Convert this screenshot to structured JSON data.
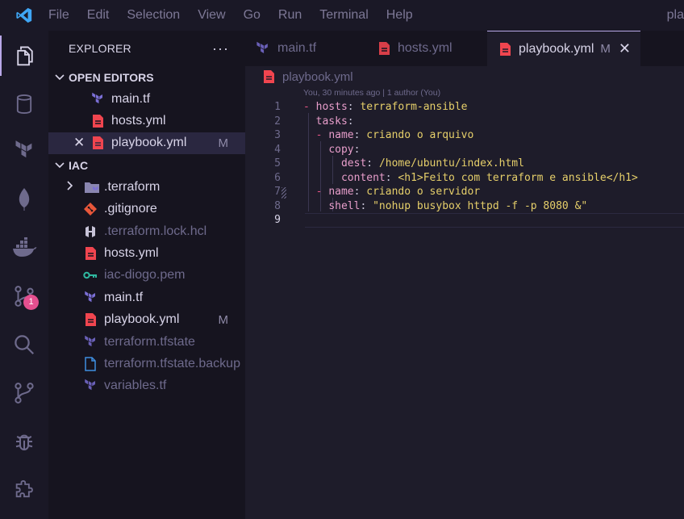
{
  "titlebar": {
    "menu": [
      "File",
      "Edit",
      "Selection",
      "View",
      "Go",
      "Run",
      "Terminal",
      "Help"
    ],
    "title": "pla"
  },
  "activitybar": {
    "items": [
      "files-icon",
      "database-icon",
      "terraform-icon",
      "mongodb-leaf-icon",
      "docker-icon",
      "source-control-icon",
      "search-icon",
      "git-graph-icon",
      "debug-icon",
      "extensions-icon"
    ],
    "scm_badge": "1"
  },
  "explorer": {
    "title": "EXPLORER",
    "more": "···",
    "open_editors_label": "OPEN EDITORS",
    "open_editors": [
      {
        "name": "main.tf",
        "icon": "terraform-icon"
      },
      {
        "name": "hosts.yml",
        "icon": "yaml-icon"
      },
      {
        "name": "playbook.yml",
        "icon": "yaml-icon",
        "status": "M"
      }
    ],
    "folder_label": "IAC",
    "files": [
      {
        "name": ".terraform",
        "icon": "folder-terraform-icon"
      },
      {
        "name": ".gitignore",
        "icon": "git-icon"
      },
      {
        "name": ".terraform.lock.hcl",
        "icon": "hcl-icon"
      },
      {
        "name": "hosts.yml",
        "icon": "yaml-icon"
      },
      {
        "name": "iac-diogo.pem",
        "icon": "key-icon"
      },
      {
        "name": "main.tf",
        "icon": "terraform-icon"
      },
      {
        "name": "playbook.yml",
        "icon": "yaml-icon",
        "status": "M"
      },
      {
        "name": "terraform.tfstate",
        "icon": "terraform-icon"
      },
      {
        "name": "terraform.tfstate.backup",
        "icon": "file-icon"
      },
      {
        "name": "variables.tf",
        "icon": "terraform-icon"
      }
    ]
  },
  "tabs": [
    {
      "label": "main.tf"
    },
    {
      "label": "hosts.yml"
    },
    {
      "label": "playbook.yml",
      "status": "M",
      "close": "✕"
    }
  ],
  "breadcrumb": "playbook.yml",
  "editor": {
    "blame": "You, 30 minutes ago | 1 author (You)",
    "line_numbers": [
      "1",
      "2",
      "3",
      "4",
      "5",
      "6",
      "7",
      "8",
      "9"
    ],
    "lines": [
      {
        "dash": "- ",
        "key": "hosts",
        "colon": ": ",
        "value": "terraform-ansible"
      },
      {
        "key": "tasks",
        "colon": ":"
      },
      {
        "dash": "- ",
        "key": "name",
        "colon": ": ",
        "value": "criando o arquivo"
      },
      {
        "key": "copy",
        "colon": ":"
      },
      {
        "key": "dest",
        "colon": ": ",
        "value": "/home/ubuntu/index.html"
      },
      {
        "key": "content",
        "colon": ": ",
        "value": "<h1>Feito com terraform e ansible</h1>"
      },
      {
        "dash": "- ",
        "key": "name",
        "colon": ": ",
        "value": "criando o servidor"
      },
      {
        "key": "shell",
        "colon": ": ",
        "value": "\"nohup busybox httpd -f -p 8080 &\""
      },
      {}
    ]
  },
  "colors": {
    "accent": "#b9a8e8",
    "yaml": "#f0454f",
    "terraform": "#7b6fd6",
    "key": "#e55486",
    "string": "#e6cf6a",
    "badge": "#e54f8f"
  }
}
